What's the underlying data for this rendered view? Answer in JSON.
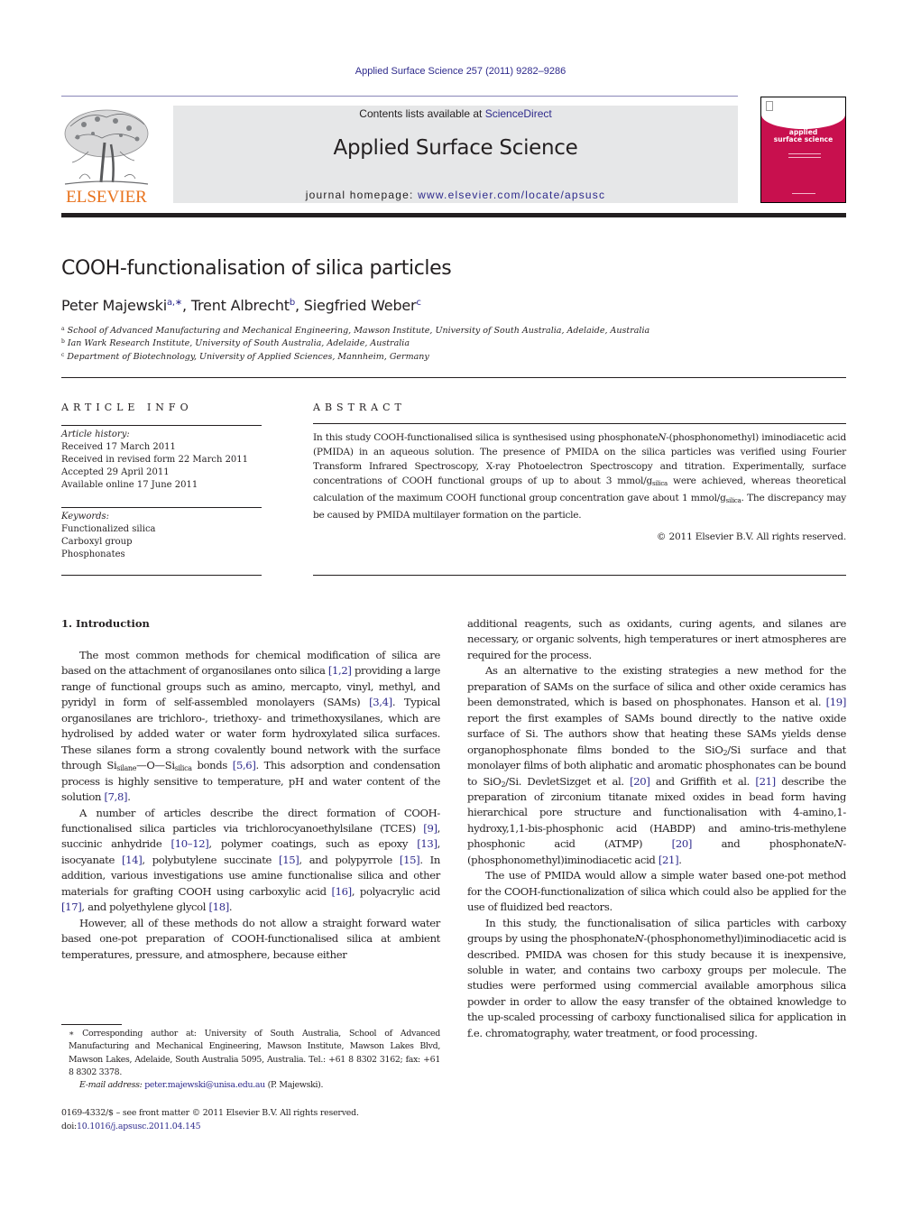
{
  "journal": {
    "citation": "Applied Surface Science 257 (2011) 9282–9286",
    "contents_prefix": "Contents lists available at ",
    "contents_link": "ScienceDirect",
    "title": "Applied Surface Science",
    "homepage_prefix": "journal homepage: ",
    "homepage_url": "www.elsevier.com/locate/apsusc",
    "publisher_logo_text": "ELSEVIER",
    "cover_title_line1": "applied",
    "cover_title_line2": "surface science"
  },
  "colors": {
    "link": "#2e2a8c",
    "elsevier_orange": "#e8711b",
    "cover_red": "#c8104e",
    "masthead_gray": "#e6e7e8"
  },
  "article": {
    "title": "COOH-functionalisation of silica particles",
    "authors": [
      {
        "name": "Peter Majewski",
        "sup": "a,∗"
      },
      {
        "name": "Trent Albrecht",
        "sup": "b"
      },
      {
        "name": "Siegfried Weber",
        "sup": "c"
      }
    ],
    "affiliations": [
      {
        "mark": "a",
        "text": "School of Advanced Manufacturing and Mechanical Engineering, Mawson Institute, University of South Australia, Adelaide, Australia"
      },
      {
        "mark": "b",
        "text": "Ian Wark Research Institute, University of South Australia, Adelaide, Australia"
      },
      {
        "mark": "c",
        "text": "Department of Biotechnology, University of Applied Sciences, Mannheim, Germany"
      }
    ]
  },
  "article_info": {
    "heading": "ARTICLE INFO",
    "history_label": "Article history:",
    "history": [
      "Received 17 March 2011",
      "Received in revised form 22 March 2011",
      "Accepted 29 April 2011",
      "Available online 17 June 2011"
    ],
    "keywords_label": "Keywords:",
    "keywords": [
      "Functionalized silica",
      "Carboxyl group",
      "Phosphonates"
    ]
  },
  "abstract": {
    "heading": "ABSTRACT",
    "p1": "In this study COOH-functionalised silica is synthesised using phosphonate",
    "p1_italic": "N",
    "p2": "-(phosphonomethyl) iminodiacetic acid (PMIDA) in an aqueous solution. The presence of PMIDA on the silica particles was verified using Fourier Transform Infrared Spectroscopy, X-ray Photoelectron Spectroscopy and titration. Experimentally, surface concentrations of COOH functional groups of up to about 3 mmol/g",
    "sub1": "silica",
    "p3": " were achieved, whereas theoretical calculation of the maximum COOH functional group concentration gave about 1 mmol/g",
    "sub2": "silica",
    "p4": ". The discrepancy may be caused by PMIDA multilayer formation on the particle.",
    "copyright": "© 2011 Elsevier B.V. All rights reserved."
  },
  "introduction": {
    "heading": "1.  Introduction",
    "left_paragraphs": {
      "p1": {
        "t1": "The most common methods for chemical modification of silica are based on the attachment of organosilanes onto silica ",
        "r1": "[1,2]",
        "t2": " providing a large range of functional groups such as amino, mercapto, vinyl, methyl, and pyridyl in form of self-assembled monolayers (SAMs) ",
        "r2": "[3,4]",
        "t3": ". Typical organosilanes are trichloro-, triethoxy- and trimethoxysilanes, which are hydrolised by added water or water form hydroxylated silica surfaces. These silanes form a strong covalently bound network with the surface through Si",
        "s1": "silane",
        "t4": "—O—Si",
        "s2": "silica",
        "t5": " bonds ",
        "r3": "[5,6]",
        "t6": ". This adsorption and condensation process is highly sensitive to temperature, pH and water content of the solution ",
        "r4": "[7,8]",
        "t7": "."
      },
      "p2": {
        "t1": "A number of articles describe the direct formation of COOH-functionalised silica particles via trichlorocyanoethylsilane (TCES) ",
        "r1": "[9]",
        "t2": ", succinic anhydride ",
        "r2": "[10–12]",
        "t3": ", polymer coatings, such as epoxy ",
        "r3": "[13]",
        "t4": ", isocyanate ",
        "r4": "[14]",
        "t5": ", polybutylene succinate ",
        "r5": "[15]",
        "t6": ", and polypyrrole ",
        "r6": "[15]",
        "t7": ". In addition, various investigations use amine functionalise silica and other materials for grafting COOH using carboxylic acid ",
        "r7": "[16]",
        "t8": ", polyacrylic acid ",
        "r8": "[17]",
        "t9": ", and polyethylene glycol ",
        "r9": "[18]",
        "t10": "."
      },
      "p3": "However, all of these methods do not allow a straight forward water based one-pot preparation of COOH-functionalised silica at ambient temperatures, pressure, and atmosphere, because either"
    },
    "right_paragraphs": {
      "p1": "additional reagents, such as oxidants, curing agents, and silanes are necessary, or organic solvents, high temperatures or inert atmospheres are required for the process.",
      "p2": {
        "t1": "As an alternative to the existing strategies a new method for the preparation of SAMs on the surface of silica and other oxide ceramics has been demonstrated, which is based on phosphonates. Hanson et al. ",
        "r1": "[19]",
        "t2": " report the first examples of SAMs bound directly to the native oxide surface of Si. The authors show that heating these SAMs yields dense organophosphonate films bonded to the SiO",
        "s1": "2",
        "t3": "/Si surface and that monolayer films of both aliphatic and aromatic phosphonates can be bound to SiO",
        "s2": "2",
        "t4": "/Si. DevletSizget et al. ",
        "r2": "[20]",
        "t5": " and Griffith et al. ",
        "r3": "[21]",
        "t6": " describe the preparation of zirconium titanate mixed oxides in bead form having hierarchical pore structure and functionalisation with 4-amino,1-hydroxy,1,1-bis-phosphonic acid (HABDP) and amino-tris-methylene phosphonic acid (ATMP) ",
        "r4": "[20]",
        "t7": " and phosphonate",
        "i1": "N",
        "t8": "-(phosphonomethyl)iminodiacetic acid ",
        "r5": "[21]",
        "t9": "."
      },
      "p3": "The use of PMIDA would allow a simple water based one-pot method for the COOH-functionalization of silica which could also be applied for the use of fluidized bed reactors.",
      "p4": {
        "t1": "In this study, the functionalisation of silica particles with carboxy groups by using the phosphonate",
        "i1": "N",
        "t2": "-(phosphonomethyl)iminodiacetic acid is described. PMIDA was chosen for this study because it is inexpensive, soluble in water, and contains two carboxy groups per molecule. The studies were performed using commercial available amorphous silica powder in order to allow the easy transfer of the obtained knowledge to the up-scaled processing of carboxy functionalised silica for application in f.e. chromatography, water treatment, or food processing."
      }
    }
  },
  "footnote": {
    "corresponding": "∗ Corresponding author at: University of South Australia, School of Advanced Manufacturing and Mechanical Engineering, Mawson Institute, Mawson Lakes Blvd, Mawson Lakes, Adelaide, South Australia 5095, Australia. Tel.: +61 8 8302 3162; fax: +61 8 8302 3378.",
    "email_label": "E-mail address: ",
    "email": "peter.majewski@unisa.edu.au",
    "email_suffix": " (P. Majewski).",
    "frontmatter": "0169-4332/$ – see front matter © 2011 Elsevier B.V. All rights reserved.",
    "doi_prefix": "doi:",
    "doi": "10.1016/j.apsusc.2011.04.145"
  }
}
